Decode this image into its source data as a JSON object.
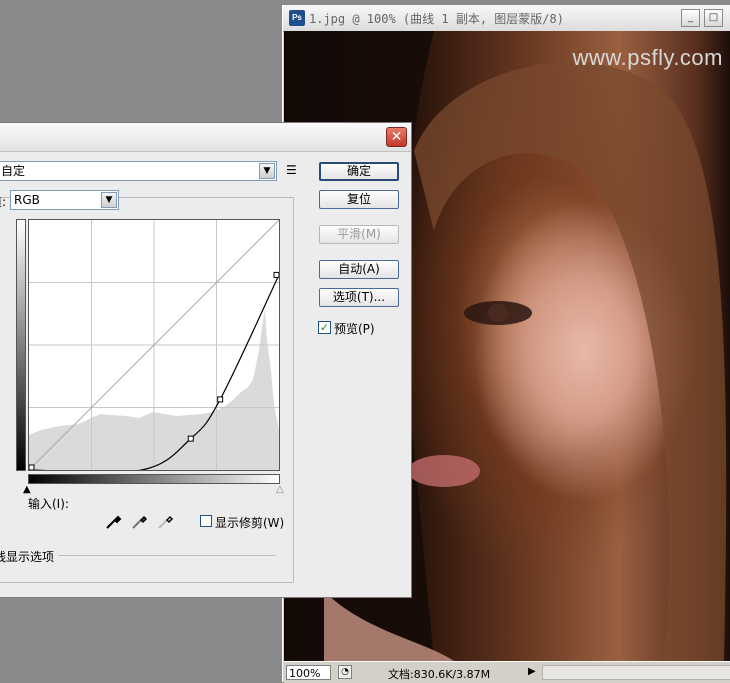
{
  "document": {
    "title": "1.jpg @ 100% (曲线 1 副本, 图层蒙版/8)",
    "app_icon": "Ps",
    "watermark": "www.psfly.com",
    "status": {
      "zoom": "100%",
      "doc_size": "文档:830.6K/3.87M"
    },
    "window_buttons": {
      "minimize": "_",
      "maximize": "□",
      "close": "×"
    }
  },
  "dialog": {
    "close_glyph": "✕",
    "preset_value": "自定",
    "preset_menu_icon": "menu-icon",
    "channel_label": "道:",
    "channel_value": "RGB",
    "input_label": "输入(I):",
    "show_clipping_label": "显示修剪(W)",
    "display_options_label": "线显示选项",
    "buttons": {
      "ok": "确定",
      "reset": "复位",
      "smooth": "平滑(M)",
      "auto": "自动(A)",
      "options": "选项(T)..."
    },
    "preview_label": "预览(P)",
    "preview_checked": true
  },
  "chart_data": {
    "type": "line",
    "series": [
      {
        "values_x": [
          0,
          115,
          165,
          195,
          255
        ],
        "values_y": [
          0,
          0,
          32,
          72,
          199
        ]
      }
    ],
    "xlim": [
      0,
      255
    ],
    "ylim": [
      0,
      255
    ],
    "grid": true,
    "control_points": [
      [
        0,
        0
      ],
      [
        165,
        32
      ],
      [
        195,
        72
      ],
      [
        255,
        199
      ]
    ]
  }
}
